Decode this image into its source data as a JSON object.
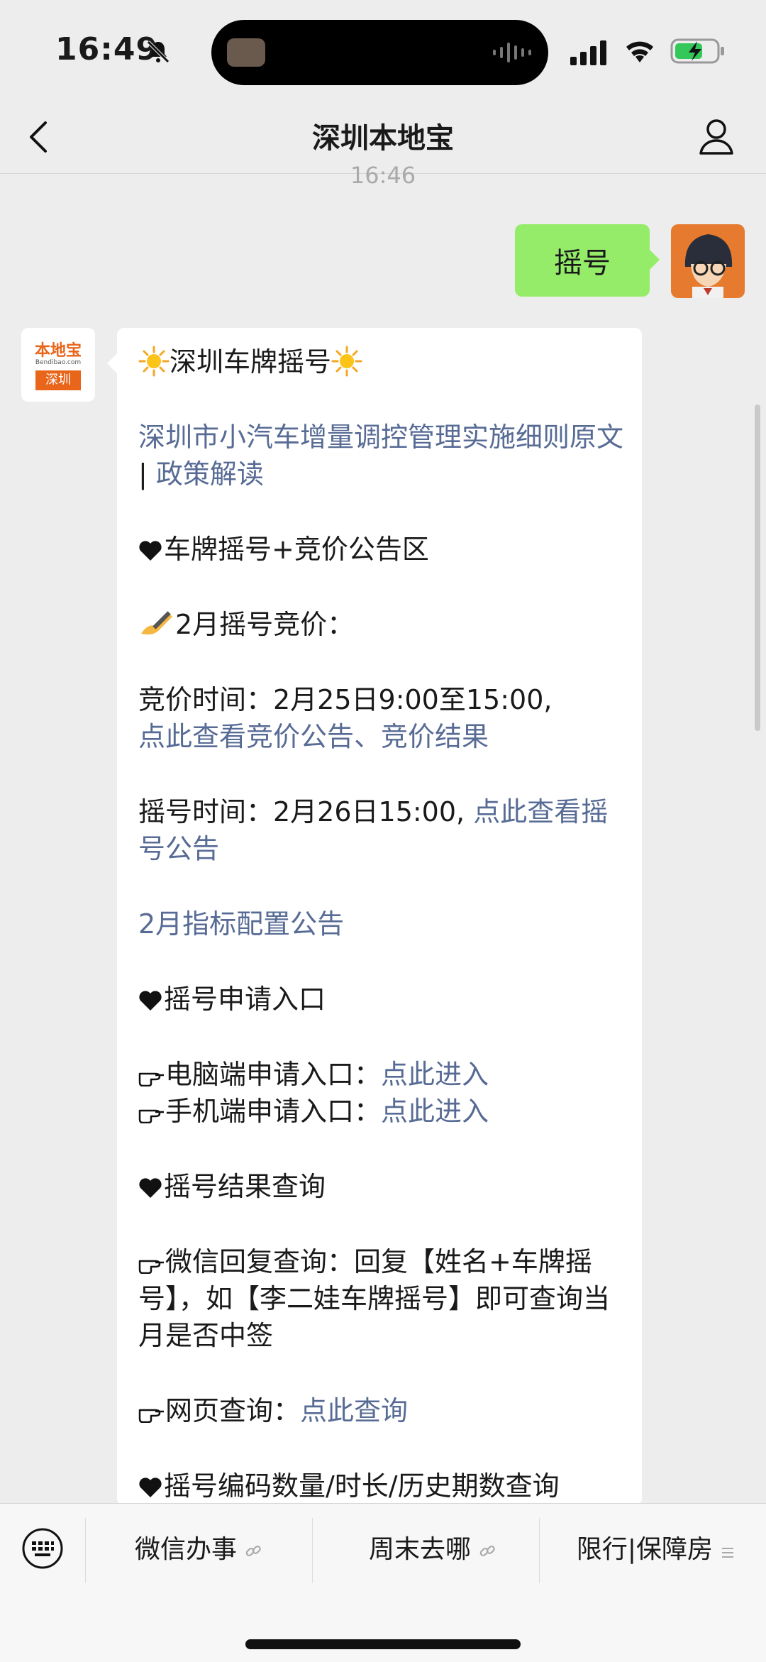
{
  "status_bar": {
    "time": "16:49"
  },
  "nav": {
    "title": "深圳本地宝"
  },
  "chat": {
    "time_separator": "16:46",
    "sent_message": "摇号",
    "brand_avatar": {
      "top": "本地宝",
      "mid": "Bendibao.com",
      "bottom": "深圳"
    },
    "received": {
      "title": "深圳车牌摇号",
      "policy_link": "深圳市小汽车增量调控管理实施细则原文",
      "sep": " | ",
      "policy_read_link": "政策解读",
      "section_announce": "车牌摇号+竞价公告区",
      "feb_heading": "2月摇号竞价：",
      "bid_time_text": "竞价时间：2月25日9:00至15:00,",
      "bid_notice_link": "点此查看竞价公告",
      "bid_sep": "、",
      "bid_result_link": "竞价结果",
      "lottery_time_text": "摇号时间：2月26日15:00,",
      "lottery_notice_link": "点此查看摇号公告",
      "quota_link": "2月指标配置公告",
      "section_apply": "摇号申请入口",
      "pc_entry_label": "电脑端申请入口：",
      "pc_entry_link": "点此进入",
      "mobile_entry_label": "手机端申请入口：",
      "mobile_entry_link": "点此进入",
      "section_result": "摇号结果查询",
      "wechat_query_text": "微信回复查询：回复【姓名+车牌摇号】，如【李二娃车牌摇号】即可查询当月是否中签",
      "web_query_label": "网页查询：",
      "web_query_link": "点此查询",
      "section_code": "摇号编码数量/时长/历史期数查询"
    }
  },
  "bottom_menu": {
    "items": [
      {
        "label": "微信办事"
      },
      {
        "label": "周末去哪"
      },
      {
        "label": "限行|保障房"
      }
    ]
  },
  "colors": {
    "link": "#576b95",
    "sent_bubble": "#95ec69",
    "brand": "#e8651a"
  }
}
